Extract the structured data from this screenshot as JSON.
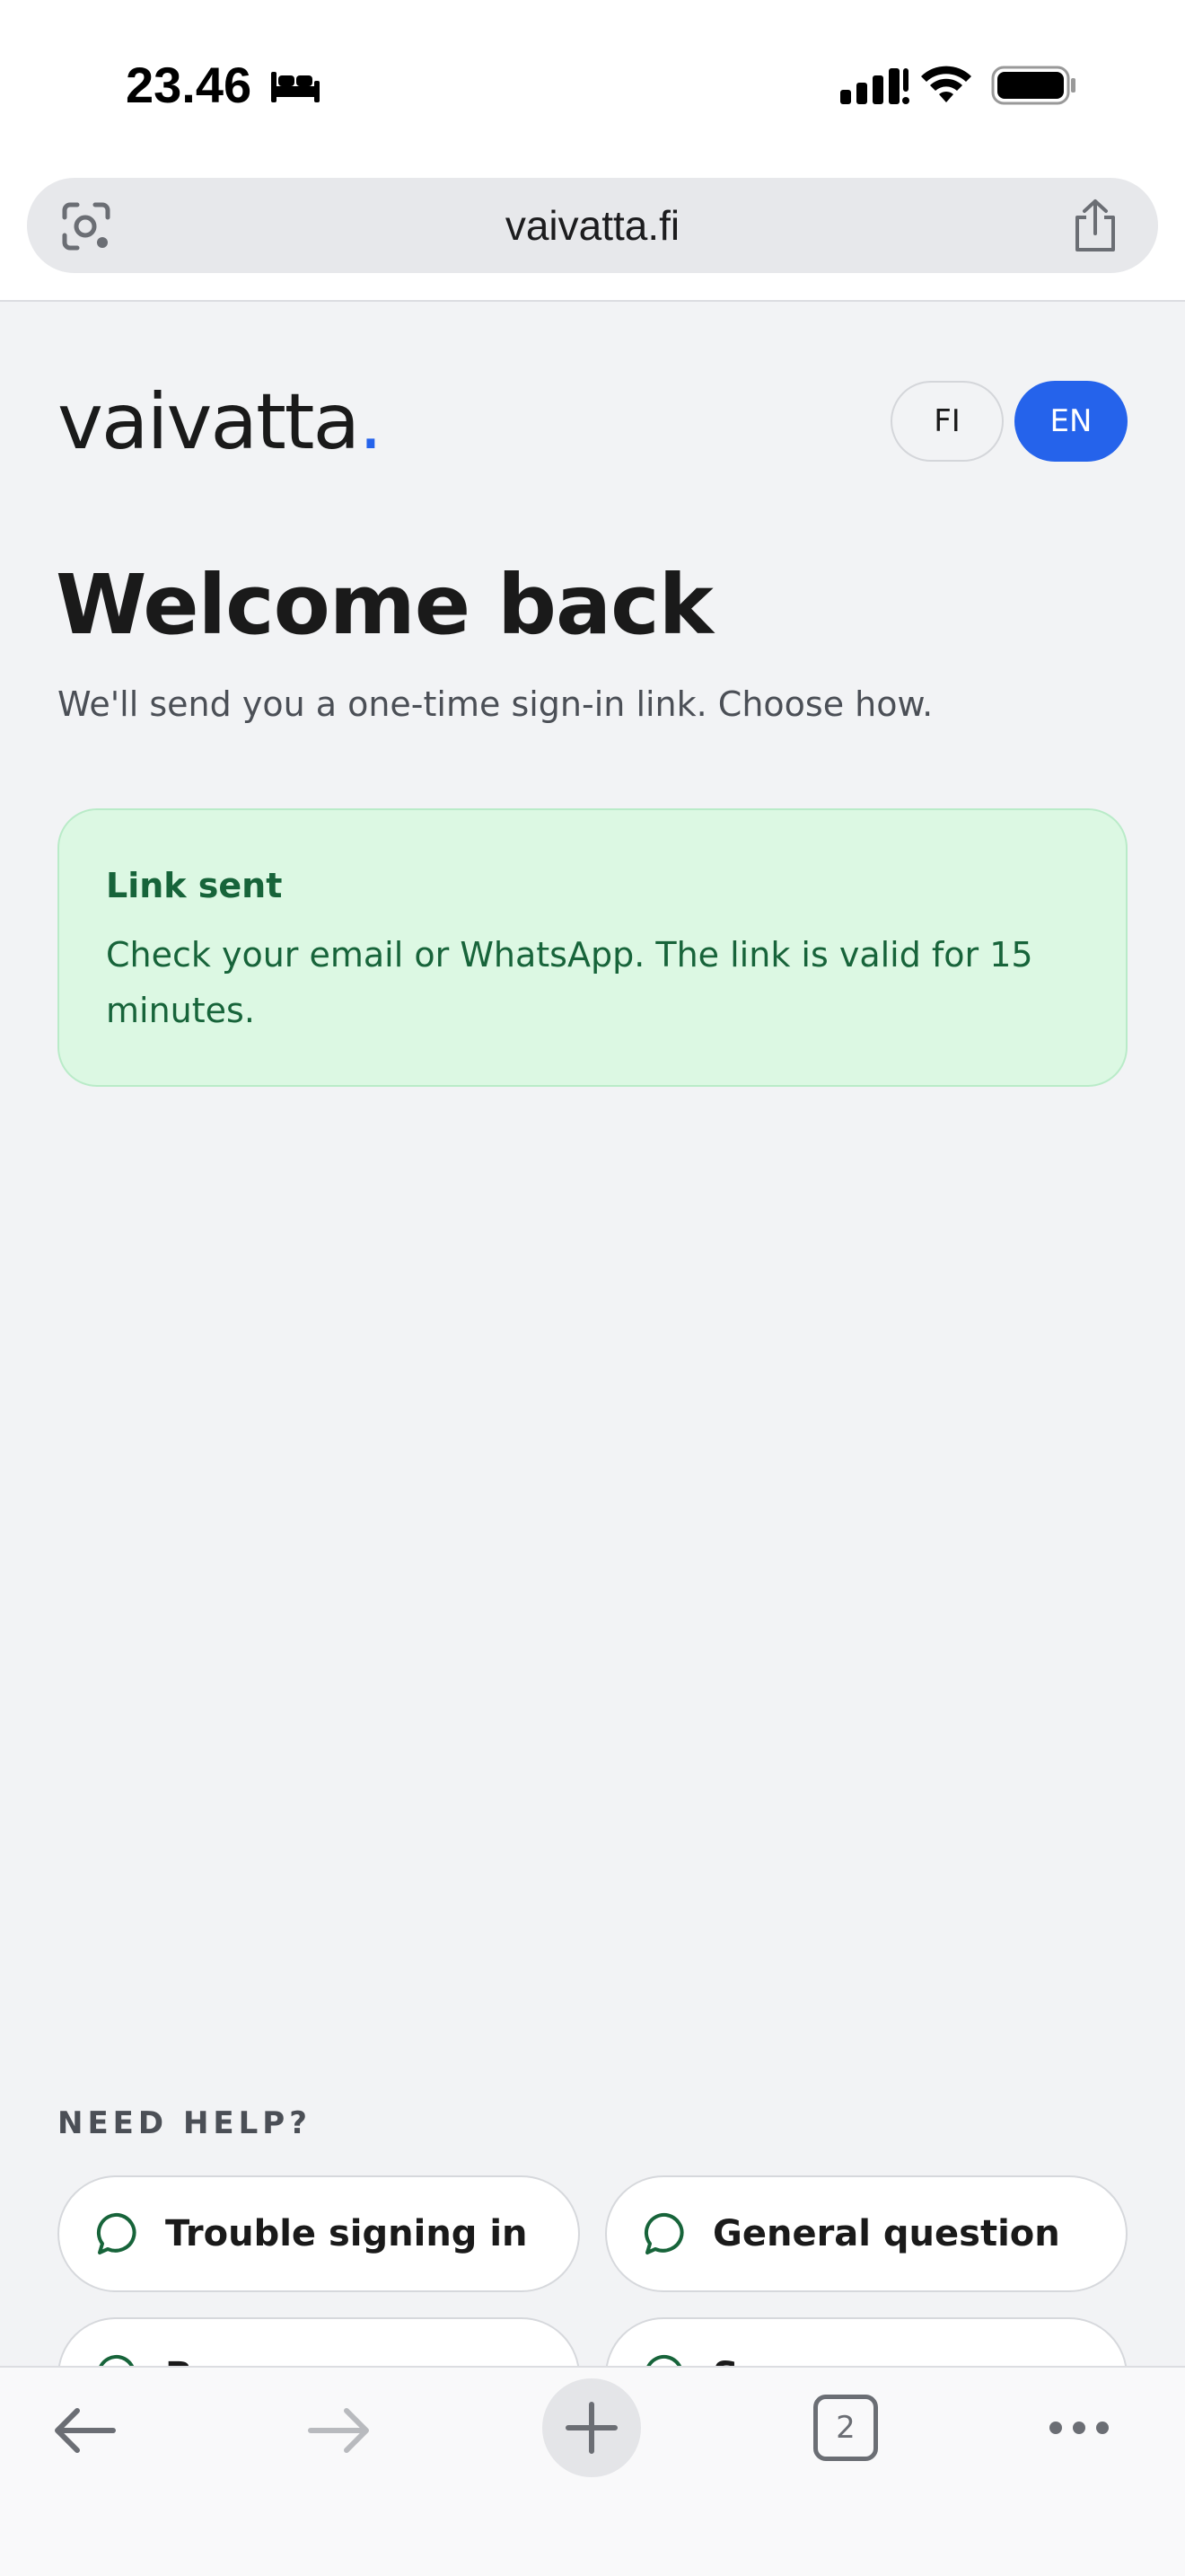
{
  "status_bar": {
    "time": "23.46",
    "icons": [
      "bed-icon",
      "cellular-signal-icon",
      "wifi-icon",
      "battery-icon"
    ]
  },
  "browser": {
    "url": "vaivatta.fi",
    "icons": [
      "visual-search-icon",
      "share-icon"
    ]
  },
  "header": {
    "logo_text": "vaivatta",
    "logo_dot": ".",
    "languages": [
      {
        "label": "FI",
        "selected": false
      },
      {
        "label": "EN",
        "selected": true
      }
    ]
  },
  "main": {
    "title": "Welcome back",
    "subtitle": "We'll send you a one-time sign-in link. Choose how.",
    "alert": {
      "title": "Link sent",
      "body": "Check your email or WhatsApp. The link is valid for 15 minutes."
    }
  },
  "help": {
    "heading": "NEED HELP?",
    "buttons": [
      {
        "label": "Trouble signing in"
      },
      {
        "label": "General question"
      },
      {
        "label": "B"
      },
      {
        "label": "S"
      }
    ]
  },
  "toolbar": {
    "tab_count": "2",
    "icons": [
      "back-arrow-icon",
      "forward-arrow-icon",
      "new-tab-icon",
      "tabs-icon",
      "more-icon"
    ]
  },
  "colors": {
    "accent": "#2563eb",
    "success_bg": "#dcf8e3",
    "success_text": "#17643a",
    "page_bg": "#f2f3f5"
  }
}
